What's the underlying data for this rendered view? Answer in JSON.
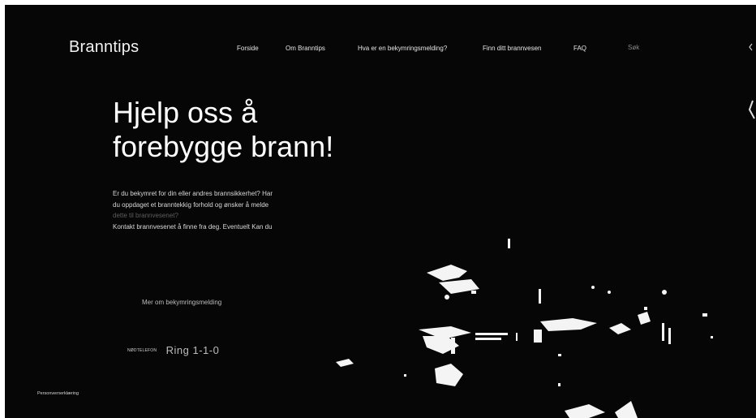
{
  "site": {
    "logo": "Branntips"
  },
  "nav": {
    "items": [
      {
        "label": "Forside"
      },
      {
        "label": "Om Branntips"
      },
      {
        "label": "Hva er en bekymringsmelding?"
      },
      {
        "label": "Finn ditt brannvesen"
      },
      {
        "label": "FAQ"
      }
    ],
    "search_placeholder": "Søk"
  },
  "hero": {
    "title_line1": "Hjelp oss å",
    "title_line2": "forebygge brann!",
    "paragraph": [
      "Er du bekymret for din eller andres brannsikkerhet? Har",
      "du oppdaget et branntekkig forhold og ønsker å melde",
      "dette til brannvesenet?",
      "Kontakt brannvesenet å finne fra deg. Eventuelt Kan du"
    ],
    "more_link": "Mer om bekymringsmelding",
    "emergency_label": "NØDTELEFON",
    "emergency_number": "Ring 1-1-0"
  },
  "footer": {
    "privacy": "Personvernerklæring"
  },
  "colors": {
    "background": "#060606",
    "text": "#ffffff"
  },
  "icons": {
    "edge": "menu-icon",
    "scene": "fire-scene-image"
  }
}
